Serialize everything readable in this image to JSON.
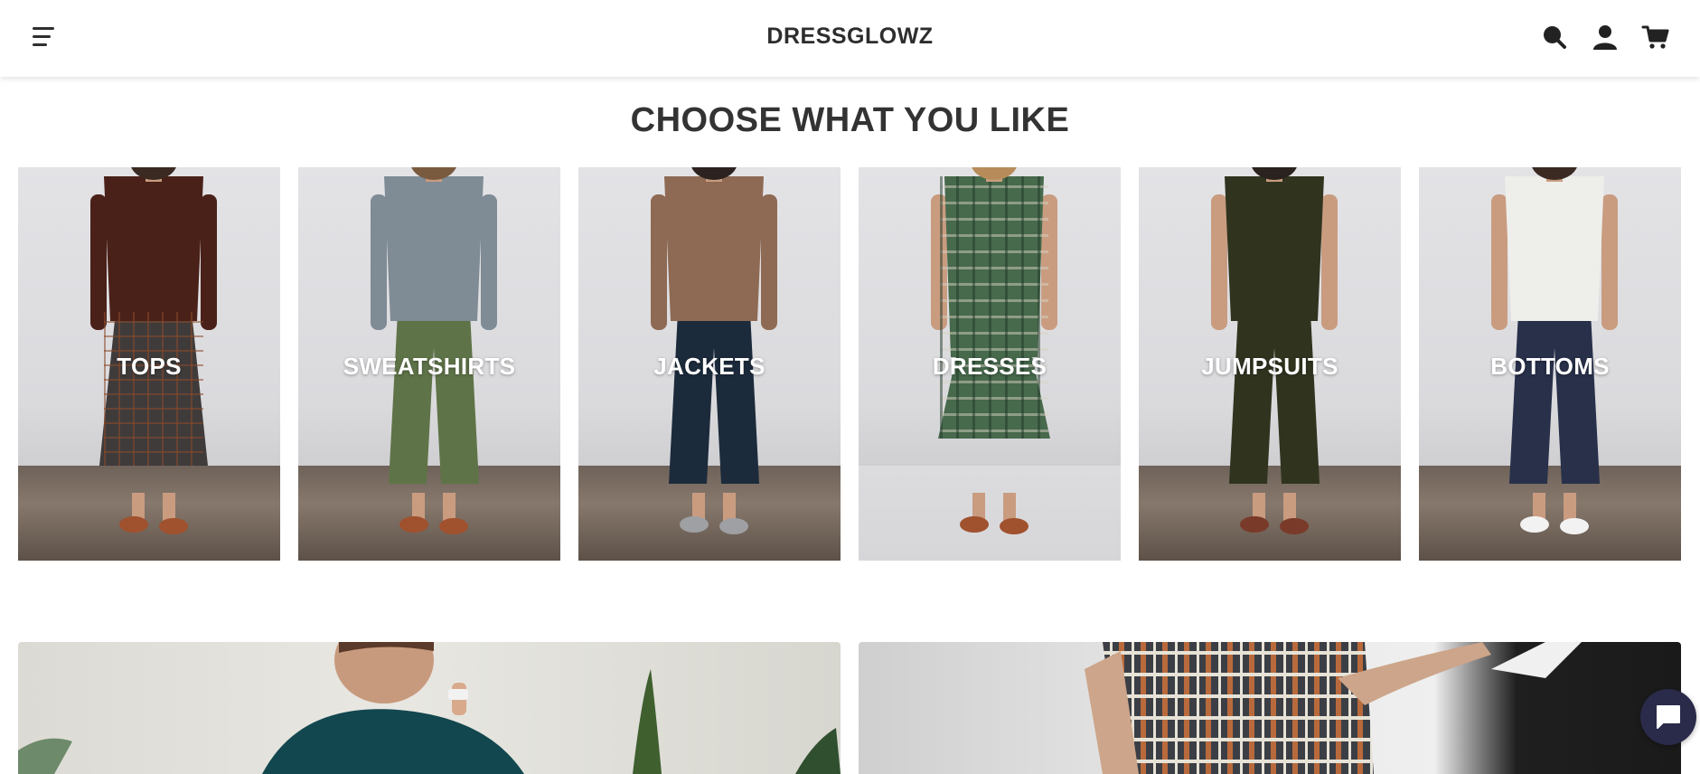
{
  "header": {
    "brand": "DRESSGLOWZ",
    "icons": [
      "menu-icon",
      "search-icon",
      "account-icon",
      "cart-icon"
    ]
  },
  "section": {
    "title": "CHOOSE WHAT YOU LIKE"
  },
  "categories": [
    {
      "label": "TOPS",
      "top_color": "#4a2119",
      "bottom_color": "#3f3b3b",
      "accent": "#a0512e"
    },
    {
      "label": "SWEATSHIRTS",
      "top_color": "#7f8b95",
      "bottom_color": "#5f7348",
      "accent": "#a0512e"
    },
    {
      "label": "JACKETS",
      "top_color": "#8e6a54",
      "bottom_color": "#1c2b3c",
      "accent": "#9ea0a3"
    },
    {
      "label": "DRESSES",
      "top_color": "#47694c",
      "bottom_color": "#47694c",
      "accent": "#a0512e"
    },
    {
      "label": "JUMPSUITS",
      "top_color": "#30341f",
      "bottom_color": "#30341f",
      "accent": "#7a3a2a"
    },
    {
      "label": "BOTTOMS",
      "top_color": "#eeeeea",
      "bottom_color": "#28304a",
      "accent": "#f2f2f2"
    }
  ],
  "colors": {
    "header_bg": "#ffffff",
    "text": "#2d2d2d",
    "chat_bg": "#2a2a4a"
  }
}
